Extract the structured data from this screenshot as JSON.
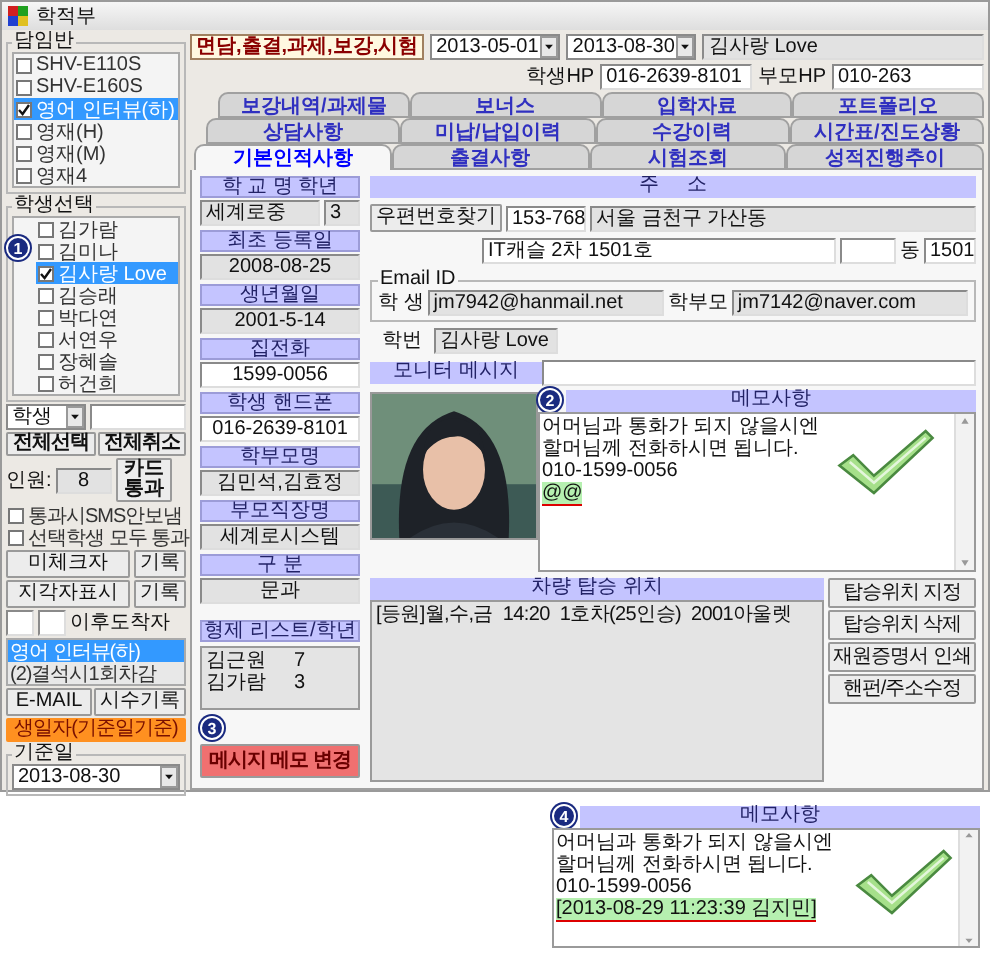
{
  "window": {
    "title": "학적부"
  },
  "homeroom": {
    "label": "담임반",
    "items": [
      {
        "label": "SHV-E110S",
        "checked": false,
        "selected": false
      },
      {
        "label": "SHV-E160S",
        "checked": false,
        "selected": false
      },
      {
        "label": "영어 인터뷰(하)",
        "checked": true,
        "selected": true
      },
      {
        "label": "영재(H)",
        "checked": false,
        "selected": false
      },
      {
        "label": "영재(M)",
        "checked": false,
        "selected": false
      },
      {
        "label": "영재4",
        "checked": false,
        "selected": false
      }
    ]
  },
  "students": {
    "label": "학생선택",
    "badge": "1",
    "items": [
      {
        "label": "김가람",
        "checked": false,
        "selected": false
      },
      {
        "label": "김미나",
        "checked": false,
        "selected": false
      },
      {
        "label": "김사랑 Love",
        "checked": true,
        "selected": true
      },
      {
        "label": "김승래",
        "checked": false,
        "selected": false
      },
      {
        "label": "박다연",
        "checked": false,
        "selected": false
      },
      {
        "label": "서연우",
        "checked": false,
        "selected": false
      },
      {
        "label": "장혜솔",
        "checked": false,
        "selected": false
      },
      {
        "label": "허건희",
        "checked": false,
        "selected": false
      }
    ]
  },
  "student_filter": {
    "value": "학생"
  },
  "select_buttons": [
    "전체선택",
    "전체취소"
  ],
  "headcount": {
    "label": "인원:",
    "value": "8",
    "button": "카드 통과"
  },
  "options": [
    {
      "label": "통과시SMS안보냄",
      "checked": false
    },
    {
      "label": "선택학생 모두 통과",
      "checked": false
    }
  ],
  "record_rows": [
    {
      "label": "미체크자",
      "button": "기록"
    },
    {
      "label": "지각자표시",
      "button": "기록"
    }
  ],
  "late_arrivals": {
    "label": "이후도착자"
  },
  "class_list": [
    {
      "label": "영어 인터뷰(하)",
      "selected": true
    },
    {
      "label": "(2)결석시1회차감",
      "selected": false
    }
  ],
  "action_buttons": [
    "E-MAIL",
    "시수기록"
  ],
  "birthday_button": "생일자(기준일기준)",
  "base_date": {
    "label": "기준일",
    "value": "2013-08-30"
  },
  "toolbar": {
    "category": "면담,출결,과제,보강,시험",
    "date_from": "2013-05-01",
    "date_to": "2013-08-30",
    "name": "김사랑 Love",
    "student_hp_label": "학생HP",
    "student_hp": "016-2639-8101",
    "parent_hp_label": "부모HP",
    "parent_hp": "010-263"
  },
  "tab_rows": [
    [
      {
        "label": "보강내역/과제물",
        "selected": false
      },
      {
        "label": "보너스",
        "selected": false
      },
      {
        "label": "입학자료",
        "selected": false
      },
      {
        "label": "포트폴리오",
        "selected": false
      }
    ],
    [
      {
        "label": "상담사항",
        "selected": false
      },
      {
        "label": "미납/납입이력",
        "selected": false
      },
      {
        "label": "수강이력",
        "selected": false
      },
      {
        "label": "시간표/진도상황",
        "selected": false
      }
    ],
    [
      {
        "label": "기본인적사항",
        "selected": true
      },
      {
        "label": "출결사항",
        "selected": false
      },
      {
        "label": "시험조회",
        "selected": false
      },
      {
        "label": "성적진행추이",
        "selected": false
      }
    ]
  ],
  "profile_fields": [
    {
      "label": "학 교 명 학년",
      "value": "세계로중",
      "value_2": "3",
      "editable": false
    },
    {
      "label": "최초 등록일",
      "value": "2008-08-25",
      "editable": false
    },
    {
      "label": "생년월일",
      "value": "2001-5-14",
      "editable": false
    },
    {
      "label": "집전화",
      "value": "1599-0056",
      "editable": true
    },
    {
      "label": "학생 핸드폰",
      "value": "016-2639-8101",
      "editable": true
    },
    {
      "label": "학부모명",
      "value": "김민석,김효정",
      "editable": false
    },
    {
      "label": "부모직장명",
      "value": "세계로시스템",
      "editable": false
    },
    {
      "label": "구 분",
      "value": "문과",
      "editable": false
    }
  ],
  "siblings": {
    "label": "형제 리스트/학년",
    "items": [
      {
        "name": "김근원",
        "grade": "7"
      },
      {
        "name": "김가람",
        "grade": "3"
      }
    ]
  },
  "memo_change_button": {
    "label": "메시지 메모 변경",
    "badge": "3"
  },
  "address": {
    "label": "주     소",
    "zip_button": "우편번호찾기",
    "zip": "153-768",
    "line_1": "서울 금천구 가산동",
    "line_2": "IT캐슬 2차 1501호",
    "dong_label": "동",
    "dong": "1501"
  },
  "email": {
    "label": "Email ID",
    "student_label": "학 생",
    "student": "jm7942@hanmail.net",
    "parent_label": "학부모",
    "parent": "jm7142@naver.com"
  },
  "student_id": {
    "label": "학번",
    "value": "김사랑 Love"
  },
  "monitor_message": {
    "label": "모니터 메시지"
  },
  "memo": {
    "label": "메모사항",
    "badge": "2",
    "lines": [
      {
        "text": "어머님과 통화가 되지 않을시엔",
        "highlighted": false
      },
      {
        "text": "할머님께 전화하시면 됩니다.",
        "highlighted": false
      },
      {
        "text": "010-1599-0056",
        "highlighted": false
      },
      {
        "text": "@@",
        "highlighted": true
      }
    ]
  },
  "vehicle": {
    "label": "차량 탑승 위치",
    "entries": [
      "[등원]월,수,금  14:20  1호차(25인승)  2001아울렛"
    ],
    "buttons": [
      "탑승위치 지정",
      "탑승위치 삭제",
      "재원증명서 인쇄",
      "핸펀/주소수정"
    ]
  },
  "memo_after": {
    "label": "메모사항",
    "badge": "4",
    "lines": [
      {
        "text": "어머님과 통화가 되지 않을시엔",
        "highlighted": false
      },
      {
        "text": "할머님께 전화하시면 됩니다.",
        "highlighted": false
      },
      {
        "text": "010-1599-0056",
        "highlighted": false
      },
      {
        "text": "[2013-08-29 11:23:39 김지민]",
        "highlighted": true
      }
    ]
  }
}
